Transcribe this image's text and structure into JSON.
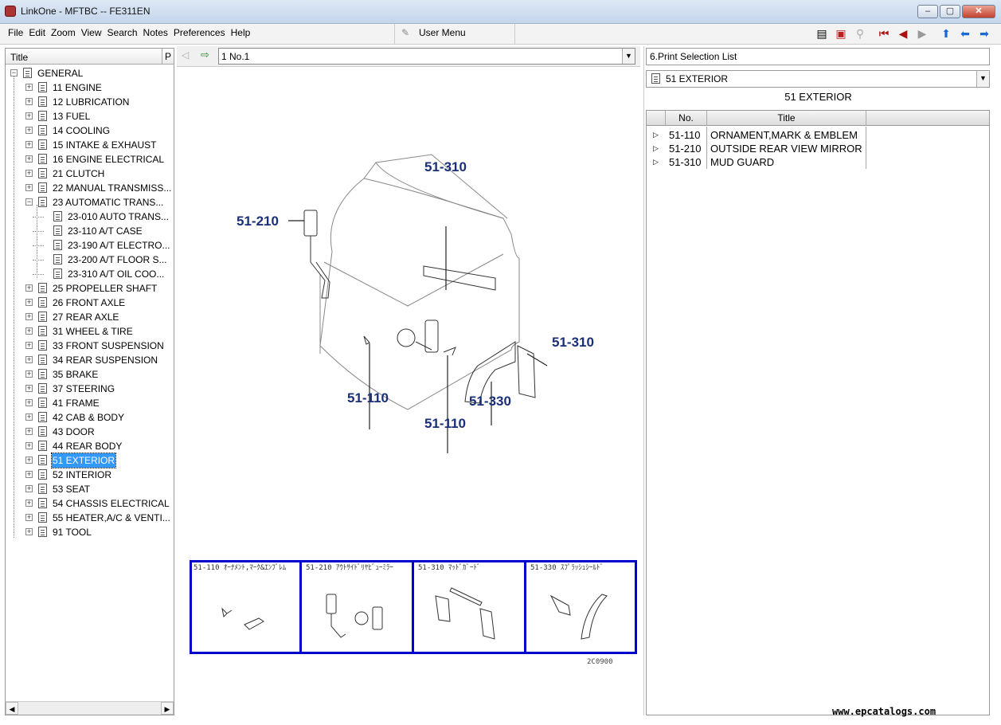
{
  "window": {
    "title": "LinkOne - MFTBC -- FE311EN"
  },
  "menu": [
    "File",
    "Edit",
    "Zoom",
    "View",
    "Search",
    "Notes",
    "Preferences",
    "Help"
  ],
  "user_menu": "User Menu",
  "left": {
    "col_title": "Title",
    "col_p": "P"
  },
  "tree": [
    {
      "label": "GENERAL",
      "level": 0,
      "sign": "-"
    },
    {
      "label": "11 ENGINE",
      "level": 1,
      "sign": "+"
    },
    {
      "label": "12 LUBRICATION",
      "level": 1,
      "sign": "+"
    },
    {
      "label": "13 FUEL",
      "level": 1,
      "sign": "+"
    },
    {
      "label": "14 COOLING",
      "level": 1,
      "sign": "+"
    },
    {
      "label": "15 INTAKE & EXHAUST",
      "level": 1,
      "sign": "+"
    },
    {
      "label": "16 ENGINE ELECTRICAL",
      "level": 1,
      "sign": "+"
    },
    {
      "label": "21 CLUTCH",
      "level": 1,
      "sign": "+"
    },
    {
      "label": "22 MANUAL TRANSMISS...",
      "level": 1,
      "sign": "+"
    },
    {
      "label": "23 AUTOMATIC TRANS...",
      "level": 1,
      "sign": "-"
    },
    {
      "label": "23-010 AUTO TRANS...",
      "level": 2,
      "sign": ""
    },
    {
      "label": "23-110 A/T CASE",
      "level": 2,
      "sign": ""
    },
    {
      "label": "23-190 A/T ELECTRO...",
      "level": 2,
      "sign": ""
    },
    {
      "label": "23-200 A/T FLOOR S...",
      "level": 2,
      "sign": ""
    },
    {
      "label": "23-310 A/T OIL COO...",
      "level": 2,
      "sign": ""
    },
    {
      "label": "25 PROPELLER SHAFT",
      "level": 1,
      "sign": "+"
    },
    {
      "label": "26 FRONT AXLE",
      "level": 1,
      "sign": "+"
    },
    {
      "label": "27 REAR AXLE",
      "level": 1,
      "sign": "+"
    },
    {
      "label": "31 WHEEL & TIRE",
      "level": 1,
      "sign": "+"
    },
    {
      "label": "33 FRONT SUSPENSION",
      "level": 1,
      "sign": "+"
    },
    {
      "label": "34 REAR SUSPENSION",
      "level": 1,
      "sign": "+"
    },
    {
      "label": "35 BRAKE",
      "level": 1,
      "sign": "+"
    },
    {
      "label": "37 STEERING",
      "level": 1,
      "sign": "+"
    },
    {
      "label": "41 FRAME",
      "level": 1,
      "sign": "+"
    },
    {
      "label": "42 CAB & BODY",
      "level": 1,
      "sign": "+"
    },
    {
      "label": "43 DOOR",
      "level": 1,
      "sign": "+"
    },
    {
      "label": "44 REAR BODY",
      "level": 1,
      "sign": "+"
    },
    {
      "label": "51 EXTERIOR",
      "level": 1,
      "sign": "+",
      "selected": true
    },
    {
      "label": "52 INTERIOR",
      "level": 1,
      "sign": "+"
    },
    {
      "label": "53 SEAT",
      "level": 1,
      "sign": "+"
    },
    {
      "label": "54 CHASSIS ELECTRICAL",
      "level": 1,
      "sign": "+"
    },
    {
      "label": "55 HEATER,A/C & VENTI...",
      "level": 1,
      "sign": "+"
    },
    {
      "label": "91 TOOL",
      "level": 1,
      "sign": "+"
    }
  ],
  "center": {
    "page_select": "1 No.1",
    "callouts": [
      "51-310",
      "51-210",
      "51-310",
      "51-110",
      "51-330",
      "51-110"
    ],
    "thumbnails": [
      {
        "caption": "51-110 ｵｰﾅﾒﾝﾄ,ﾏｰｸ&ｴﾝﾌﾞﾚﾑ"
      },
      {
        "caption": "51-210 ｱｳﾄｻｲﾄﾞﾘﾔﾋﾞｭｰﾐﾗｰ"
      },
      {
        "caption": "51-310 ﾏｯﾄﾞｶﾞｰﾄﾞ"
      },
      {
        "caption": "51-330 ｽﾌﾟﾗｯｼｭｼｰﾙﾄﾞ"
      }
    ],
    "figure_code": "2C0900"
  },
  "right": {
    "list_name": "6.Print Selection List",
    "section_select": "51 EXTERIOR",
    "heading": "51 EXTERIOR",
    "columns": {
      "no": "No.",
      "title": "Title"
    },
    "rows": [
      {
        "no": "51-110",
        "title": "ORNAMENT,MARK & EMBLEM"
      },
      {
        "no": "51-210",
        "title": "OUTSIDE REAR VIEW MIRROR"
      },
      {
        "no": "51-310",
        "title": "MUD GUARD"
      }
    ]
  },
  "footer": "www.epcatalogs.com",
  "colors": {
    "callout": "#1a2f7a",
    "thumb_border": "#0000cc",
    "selection": "#3399ff"
  }
}
